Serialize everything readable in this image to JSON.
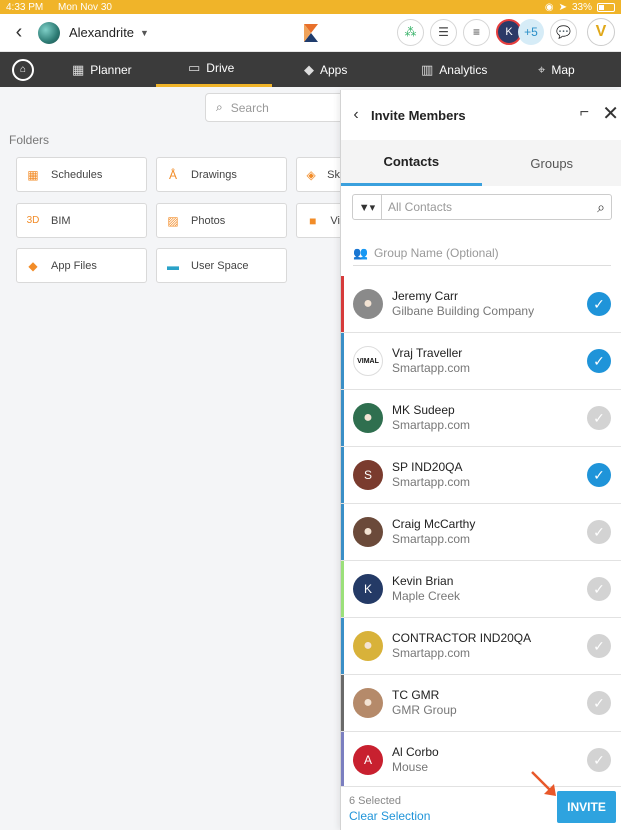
{
  "status": {
    "time": "4:33 PM",
    "date": "Mon Nov 30",
    "battery": "33%"
  },
  "header": {
    "project_name": "Alexandrite",
    "more_members": "+5",
    "member_initial": "K",
    "user_initial": "V"
  },
  "nav": {
    "planner": "Planner",
    "drive": "Drive",
    "apps": "Apps",
    "analytics": "Analytics",
    "map": "Map"
  },
  "drive": {
    "search_placeholder": "Search",
    "folders_label": "Folders",
    "folders": [
      {
        "label": "Schedules",
        "icon": "calendar-icon"
      },
      {
        "label": "Drawings",
        "icon": "compass-icon"
      },
      {
        "label": "Sk",
        "icon": "sketch-icon"
      },
      {
        "label": "BIM",
        "icon": "3d-icon"
      },
      {
        "label": "Photos",
        "icon": "photo-icon"
      },
      {
        "label": "Vi",
        "icon": "video-icon"
      },
      {
        "label": "App Files",
        "icon": "app-icon"
      },
      {
        "label": "User Space",
        "icon": "drive-icon"
      }
    ]
  },
  "invite": {
    "title": "Invite Members",
    "tabs": [
      "Contacts",
      "Groups"
    ],
    "filter_placeholder": "All Contacts",
    "group_placeholder": "Group Name (Optional)",
    "contacts": [
      {
        "name": "Jeremy Carr",
        "company": "Gilbane Building Company",
        "selected": true,
        "stripe": "#d63b3b",
        "avatar": "photo",
        "avatar_bg": "#8a8a8a"
      },
      {
        "name": "Vraj Traveller",
        "company": "Smartapp.com",
        "selected": true,
        "stripe": "#3a8fc7",
        "avatar": "VIMAL",
        "avatar_bg": "#ffffff"
      },
      {
        "name": "MK Sudeep",
        "company": "Smartapp.com",
        "selected": false,
        "stripe": "#3a8fc7",
        "avatar": "photo",
        "avatar_bg": "#2f6f4f"
      },
      {
        "name": "SP IND20QA",
        "company": "Smartapp.com",
        "selected": true,
        "stripe": "#3a8fc7",
        "avatar": "S",
        "avatar_bg": "#7a3b2e"
      },
      {
        "name": "Craig McCarthy",
        "company": "Smartapp.com",
        "selected": false,
        "stripe": "#3a8fc7",
        "avatar": "photo",
        "avatar_bg": "#6b4a3a"
      },
      {
        "name": "Kevin Brian",
        "company": "Maple Creek",
        "selected": false,
        "stripe": "#9be07a",
        "avatar": "K",
        "avatar_bg": "#243a66"
      },
      {
        "name": "CONTRACTOR IND20QA",
        "company": "Smartapp.com",
        "selected": false,
        "stripe": "#3a8fc7",
        "avatar": "photo",
        "avatar_bg": "#d8b23a"
      },
      {
        "name": "TC GMR",
        "company": "GMR Group",
        "selected": false,
        "stripe": "#6a6a6a",
        "avatar": "photo",
        "avatar_bg": "#b58a6a"
      },
      {
        "name": "Al Corbo",
        "company": "Mouse",
        "selected": false,
        "stripe": "#7b7fc0",
        "avatar": "A",
        "avatar_bg": "#c8202f"
      }
    ],
    "selected_count": "6 Selected",
    "clear_label": "Clear Selection",
    "invite_label": "INVITE"
  }
}
